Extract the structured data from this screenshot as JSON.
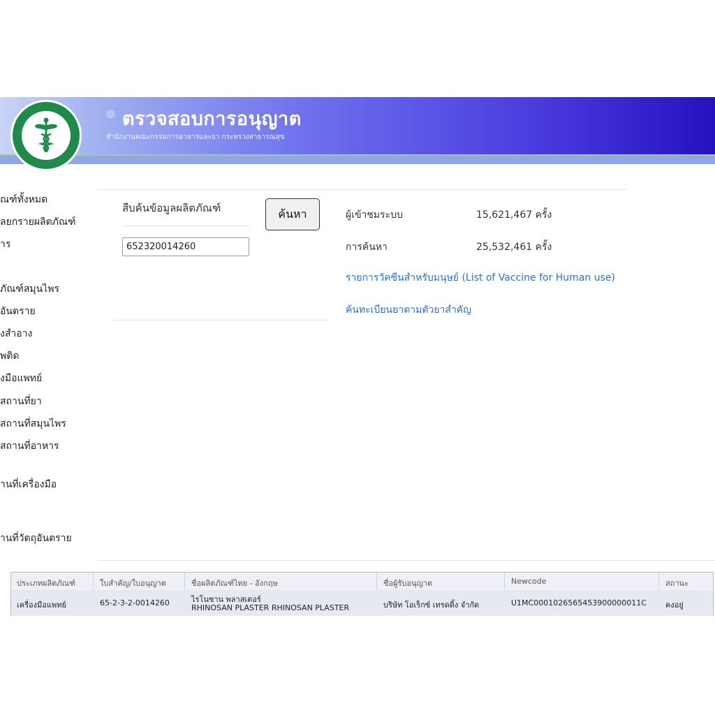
{
  "header": {
    "title": "ตรวจสอบการอนุญาต",
    "subtitle": "สำนักงานคณะกรรมการอาหารและยา กระทรวงสาธารณสุข",
    "logo_text": "MINISTRY OF PUBLIC HEALTH"
  },
  "sidebar": {
    "items": [
      {
        "label": "ณฑ์ทั้งหมด"
      },
      {
        "label": "ลยกรายผลิตภัณฑ์"
      },
      {
        "label": "าร"
      },
      {
        "label": "ภัณฑ์สมุนไพร"
      },
      {
        "label": "อันตราย"
      },
      {
        "label": "งสำอาง"
      },
      {
        "label": "พติด"
      },
      {
        "label": "งมือแพทย์"
      },
      {
        "label": "สถานที่ยา"
      },
      {
        "label": "สถานที่สมุนไพร"
      },
      {
        "label": "สถานที่อาหาร"
      },
      {
        "label": "านที่เครื่องมือ"
      },
      {
        "label": "านที่วัตถุอันตราย"
      }
    ]
  },
  "search": {
    "label": "สืบค้นข้อมูลผลิตภัณฑ์",
    "value": "652320014260",
    "button_label": "ค้นหา"
  },
  "stats": {
    "visitors_label": "ผู้เข้าชมระบบ",
    "visitors_value": "15,621,467 ครั้ง",
    "searches_label": "การค้นหา",
    "searches_value": "25,532,461 ครั้ง"
  },
  "links": {
    "vaccine": "รายการวัคซีนสำหรับมนุษย์ (List of Vaccine for Human use)",
    "drug_search": "ค้นทะเบียนยาตามตัวยาสำคัญ"
  },
  "results": {
    "headers": [
      "ประเภทผลิตภัณฑ์",
      "ใบสำคัญ/ใบอนุญาต",
      "ชื่อผลิตภัณฑ์ไทย - อังกฤษ",
      "ชื่อผู้รับอนุญาต",
      "Newcode",
      "สถานะ"
    ],
    "rows": [
      {
        "type": "เครื่องมือแพทย์",
        "license": "65-2-3-2-0014260",
        "name_th": "ไรโนซาน พลาสเตอร์",
        "name_en": "RHINOSAN PLASTER RHINOSAN PLASTER",
        "licensee": "บริษัท โอเร็กซ์ เทรดดิ้ง จำกัด",
        "newcode": "U1MC0001026565453900000011C",
        "status": "คงอยู่"
      }
    ]
  }
}
